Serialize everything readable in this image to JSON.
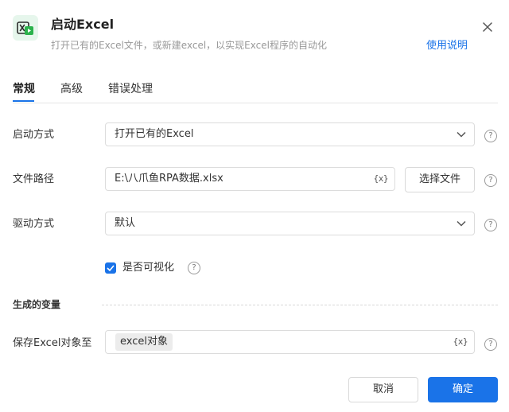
{
  "header": {
    "title": "启动Excel",
    "subtitle": "打开已有的Excel文件，或新建excel，以实现Excel程序的自动化",
    "help_link": "使用说明",
    "icon": "excel-start-icon"
  },
  "tabs": [
    {
      "label": "常规",
      "active": true
    },
    {
      "label": "高级",
      "active": false
    },
    {
      "label": "错误处理",
      "active": false
    }
  ],
  "form": {
    "launch_mode": {
      "label": "启动方式",
      "value": "打开已有的Excel"
    },
    "file_path": {
      "label": "文件路径",
      "value": "E:\\八爪鱼RPA数据.xlsx",
      "var_button": "{x}",
      "browse_button": "选择文件"
    },
    "driver_mode": {
      "label": "驱动方式",
      "value": "默认"
    },
    "visible": {
      "label": "是否可视化",
      "checked": true
    }
  },
  "output_section": {
    "title": "生成的变量",
    "save_to": {
      "label": "保存Excel对象至",
      "tag": "excel对象",
      "var_button": "{x}"
    }
  },
  "footer": {
    "cancel": "取消",
    "ok": "确定"
  },
  "colors": {
    "accent": "#1a73e8",
    "icon_bg": "#e6f6ec",
    "icon_green": "#2bb24c"
  }
}
